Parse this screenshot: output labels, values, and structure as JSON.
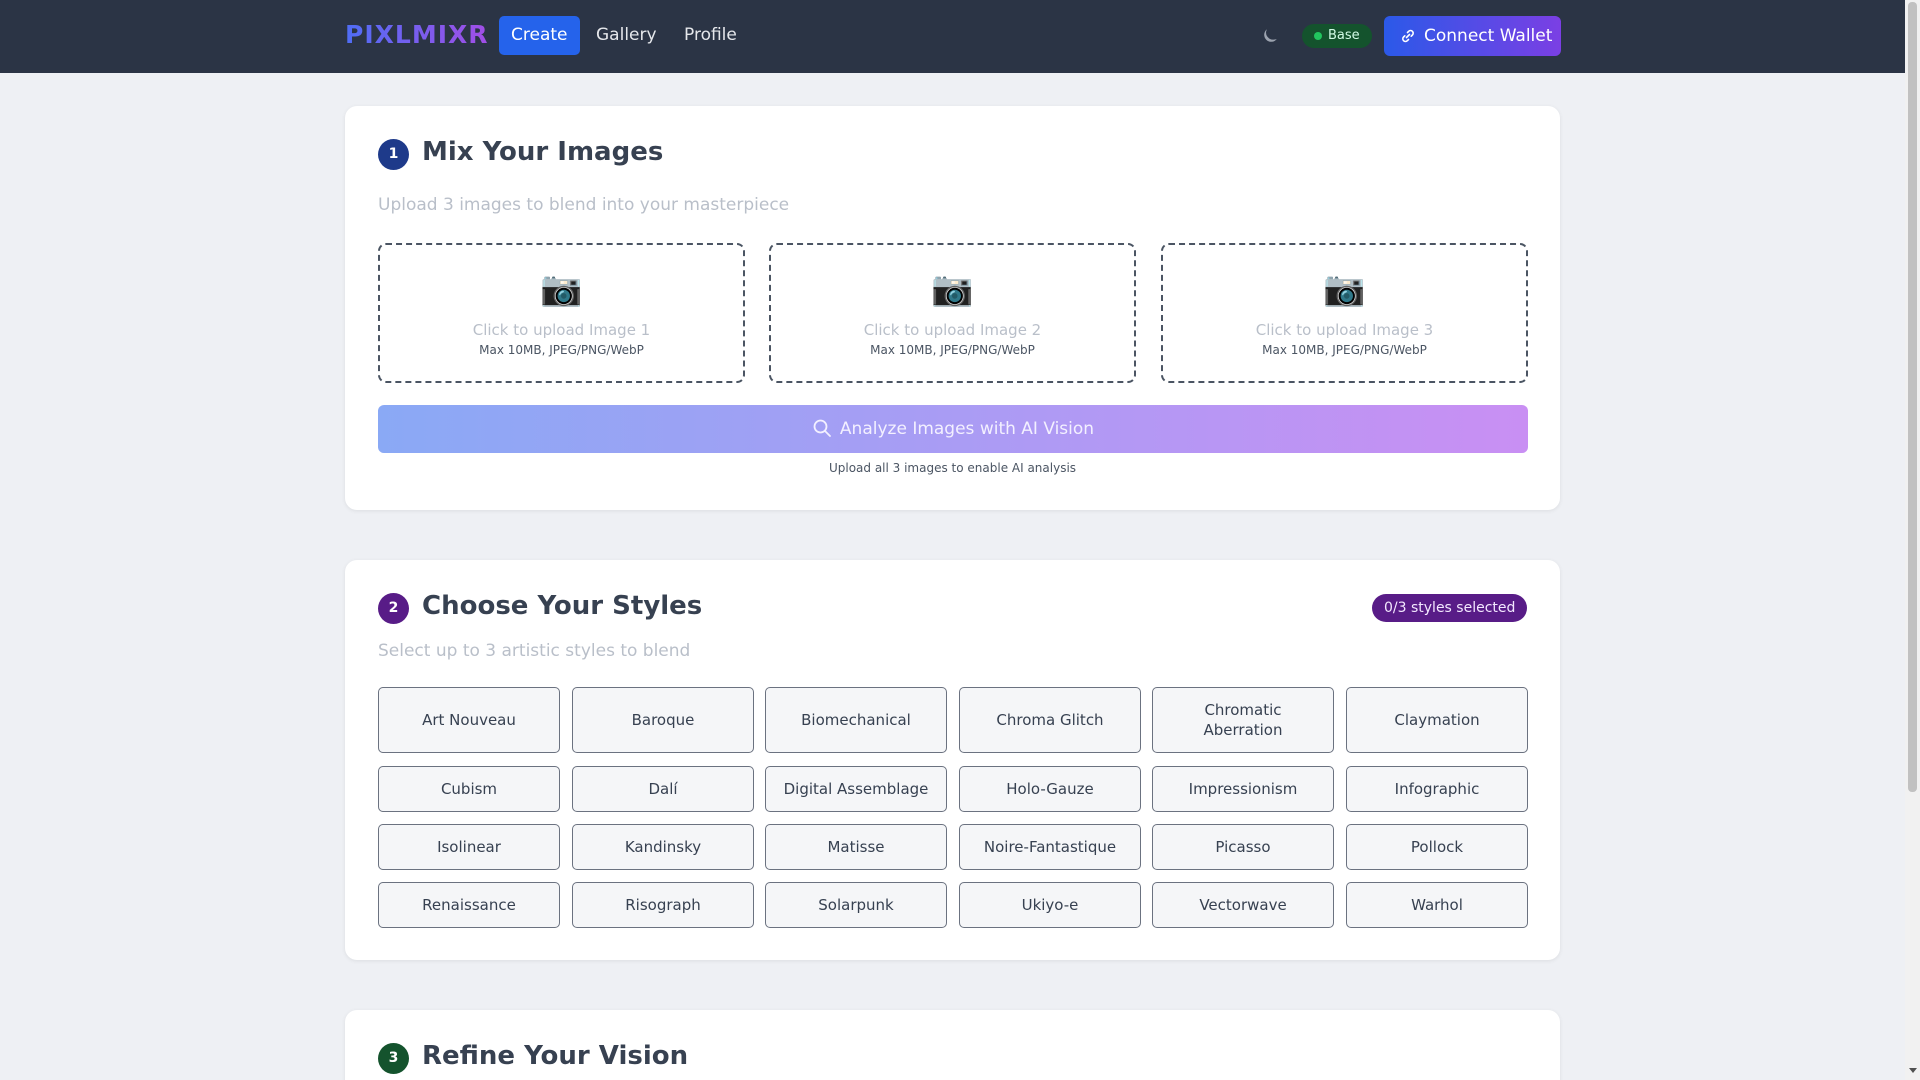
{
  "nav": {
    "brand": "PIXLMIXR",
    "links": [
      {
        "label": "Create",
        "active": true
      },
      {
        "label": "Gallery",
        "active": false
      },
      {
        "label": "Profile",
        "active": false
      }
    ],
    "theme_icon": "moon-icon",
    "network_label": "Base",
    "connect_label": "Connect Wallet",
    "connect_icon": "link-icon"
  },
  "step1": {
    "number": "1",
    "title": "Mix Your Images",
    "subtitle": "Upload 3 images to blend into your masterpiece",
    "uploads": [
      {
        "icon": "📷",
        "label": "Click to upload Image 1",
        "hint": "Max 10MB, JPEG/PNG/WebP"
      },
      {
        "icon": "📷",
        "label": "Click to upload Image 2",
        "hint": "Max 10MB, JPEG/PNG/WebP"
      },
      {
        "icon": "📷",
        "label": "Click to upload Image 3",
        "hint": "Max 10MB, JPEG/PNG/WebP"
      }
    ],
    "analyze_label": "Analyze Images with AI Vision",
    "analyze_icon": "search-icon",
    "analyze_hint": "Upload all 3 images to enable AI analysis"
  },
  "step2": {
    "number": "2",
    "title": "Choose Your Styles",
    "subtitle": "Select up to 3 artistic styles to blend",
    "badge": "0/3 styles selected",
    "styles": [
      [
        "Art Nouveau",
        "Baroque",
        "Biomechanical",
        "Chroma Glitch",
        "Chromatic Aberration",
        "Claymation"
      ],
      [
        "Cubism",
        "Dalí",
        "Digital Assemblage",
        "Holo-Gauze",
        "Impressionism",
        "Infographic"
      ],
      [
        "Isolinear",
        "Kandinsky",
        "Matisse",
        "Noire-Fantastique",
        "Picasso",
        "Pollock"
      ],
      [
        "Renaissance",
        "Risograph",
        "Solarpunk",
        "Ukiyo-e",
        "Vectorwave",
        "Warhol"
      ]
    ]
  },
  "step3": {
    "number": "3",
    "title": "Refine Your Vision"
  },
  "colors": {
    "step1": "#1e3a8a",
    "step2": "#581c87",
    "step3": "#14532d",
    "accent": "#2563eb"
  }
}
